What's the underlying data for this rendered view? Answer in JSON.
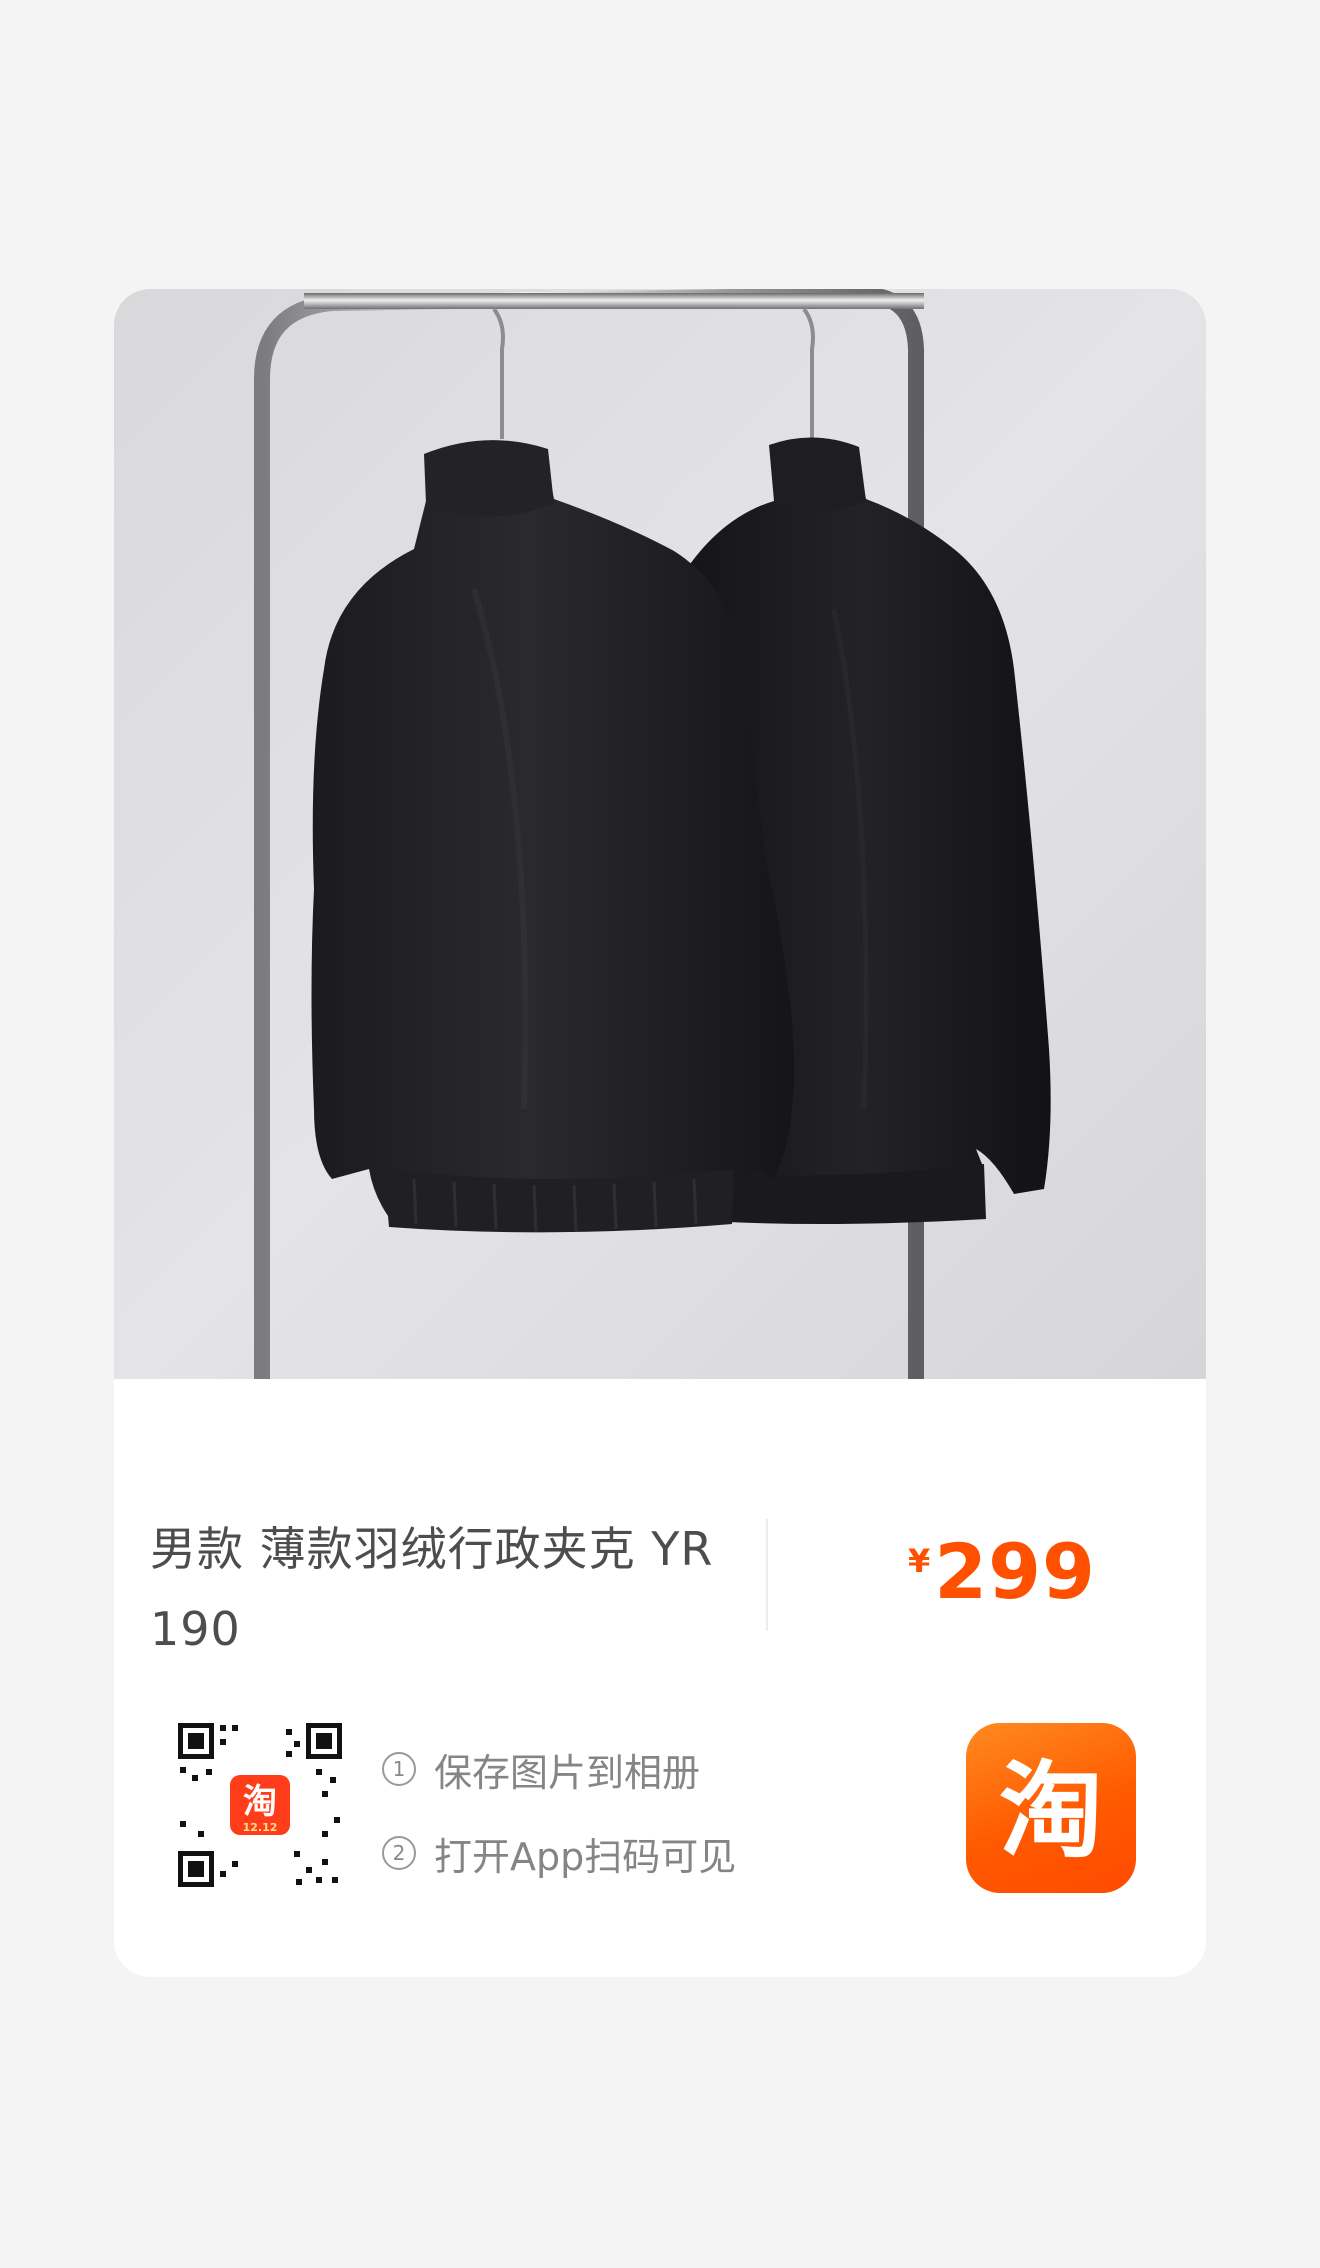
{
  "product": {
    "title": "男款 薄款羽绒行政夹克 YR 190",
    "currency_symbol": "¥",
    "price": "299",
    "image_description_icon": "product-photo"
  },
  "share": {
    "step1_num": "①",
    "step1": "保存图片到相册",
    "step2_num": "②",
    "step2": "打开App扫码可见",
    "qr_badge_text": "12.12",
    "qr_badge_char": "淘"
  },
  "app": {
    "logo_char": "淘",
    "brand_color": "#ff5000"
  }
}
